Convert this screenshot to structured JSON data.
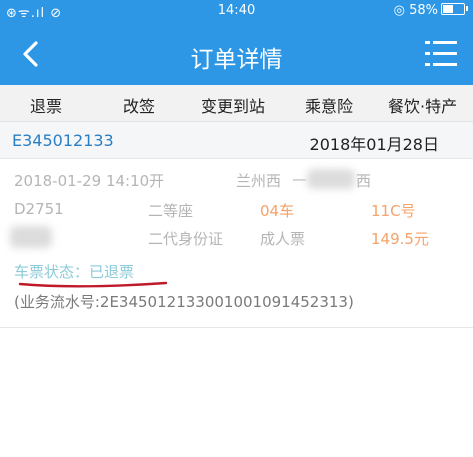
{
  "status_bar": {
    "signal": "⊛ᯤ.ıl ⊘",
    "time": "14:40",
    "battery": "◎ 58%"
  },
  "header": {
    "title": "订单详情"
  },
  "actions": [
    "退票",
    "改签",
    "变更到站",
    "乘意险",
    "餐饮·特产"
  ],
  "order": {
    "id": "E345012133",
    "date": "2018年01月28日"
  },
  "ticket": {
    "departure": "2018-01-29  14:10开",
    "from_station": "兰州西",
    "arrow": "—",
    "to_station_suffix": "西",
    "train": "D2751",
    "seat_class": "二等座",
    "car": "04车",
    "seat": "11C号",
    "id_type": "二代身份证",
    "ticket_type": "成人票",
    "price": "149.5元",
    "status_label": "车票状态：已退票",
    "serial": "(业务流水号:2E3450121330010010914523​13)"
  },
  "colors": {
    "brand_blue": "#2d97e6",
    "order_id": "#2a7fc4",
    "orange_text": "#f5a26b",
    "status_text": "#8bcbd8",
    "underline_red": "#c0192a"
  }
}
